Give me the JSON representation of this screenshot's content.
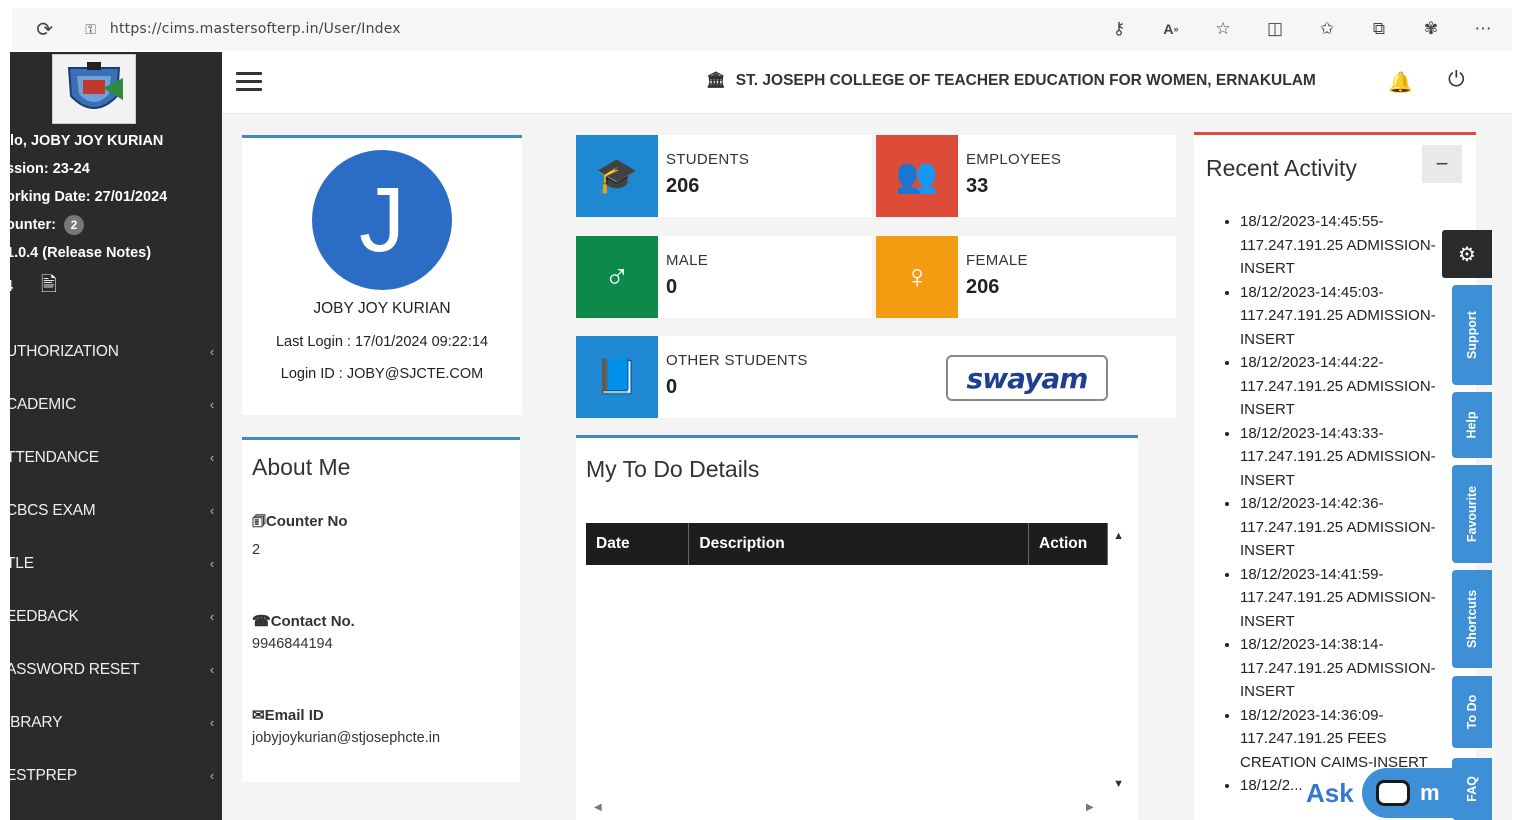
{
  "browser": {
    "url": "https://cims.mastersofterp.in/User/Index",
    "reload_icon": "reload-icon",
    "icons": [
      "key-icon",
      "read-aloud-icon",
      "favorite-star-icon",
      "split-screen-icon",
      "favorites-icon",
      "collections-icon",
      "extensions-icon",
      "more-icon"
    ]
  },
  "sidebar": {
    "greeting": "llo, JOBY JOY KURIAN",
    "session": "ssion: 23-24",
    "working_date": "orking Date: 27/01/2024",
    "counter_label": "ounter:",
    "counter_value": "2",
    "version": "1.0.4 (Release Notes)",
    "tool_number": "4",
    "menu": [
      {
        "label": "UTHORIZATION"
      },
      {
        "label": "CADEMIC"
      },
      {
        "label": "TTENDANCE"
      },
      {
        "label": "CBCS EXAM"
      },
      {
        "label": "TLE"
      },
      {
        "label": "EEDBACK"
      },
      {
        "label": "ASSWORD RESET"
      },
      {
        "label": "IBRARY"
      },
      {
        "label": "ESTPREP"
      }
    ]
  },
  "topbar": {
    "college_name": "ST. JOSEPH COLLEGE OF TEACHER EDUCATION FOR WOMEN, ERNAKULAM"
  },
  "profile": {
    "initial": "J",
    "name": "JOBY JOY KURIAN",
    "last_login": "Last Login : 17/01/2024 09:22:14",
    "login_id": "Login ID : JOBY@SJCTE.COM"
  },
  "about": {
    "title": "About Me",
    "counter_label": "Counter No",
    "counter_value": "2",
    "contact_label": "Contact No.",
    "contact_value": "9946844194",
    "email_label": "Email ID",
    "email_value": "jobyjoykurian@stjosephcte.in"
  },
  "stats": {
    "students": {
      "label": "STUDENTS",
      "value": "206",
      "color": "#1e88d3",
      "icon": "graduation-cap-icon"
    },
    "employees": {
      "label": "EMPLOYEES",
      "value": "33",
      "color": "#dd4b39",
      "icon": "group-icon"
    },
    "male": {
      "label": "MALE",
      "value": "0",
      "color": "#0d8a4a",
      "icon": "male-icon"
    },
    "female": {
      "label": "FEMALE",
      "value": "206",
      "color": "#f39c12",
      "icon": "female-icon"
    },
    "other": {
      "label": "OTHER STUDENTS",
      "value": "0",
      "color": "#1e88d3",
      "icon": "book-icon"
    }
  },
  "swayam": {
    "text": "swayam"
  },
  "todo": {
    "title": "My To Do Details",
    "columns": [
      "Date",
      "Description",
      "Action"
    ]
  },
  "activity": {
    "title": "Recent Activity",
    "items": [
      "18/12/2023-14:45:55-117.247.191.25 ADMISSION-INSERT",
      "18/12/2023-14:45:03-117.247.191.25 ADMISSION-INSERT",
      "18/12/2023-14:44:22-117.247.191.25 ADMISSION-INSERT",
      "18/12/2023-14:43:33-117.247.191.25 ADMISSION-INSERT",
      "18/12/2023-14:42:36-117.247.191.25 ADMISSION-INSERT",
      "18/12/2023-14:41:59-117.247.191.25 ADMISSION-INSERT",
      "18/12/2023-14:38:14-117.247.191.25 ADMISSION-INSERT",
      "18/12/2023-14:36:09-117.247.191.25 FEES CREATION CAIMS-INSERT",
      "18/12/2..."
    ]
  },
  "side_tabs": [
    "Support",
    "Help",
    "Favourite",
    "Shortcuts",
    "To Do",
    "FAQ"
  ],
  "chat": {
    "ask": "Ask",
    "pill_text": "m"
  }
}
